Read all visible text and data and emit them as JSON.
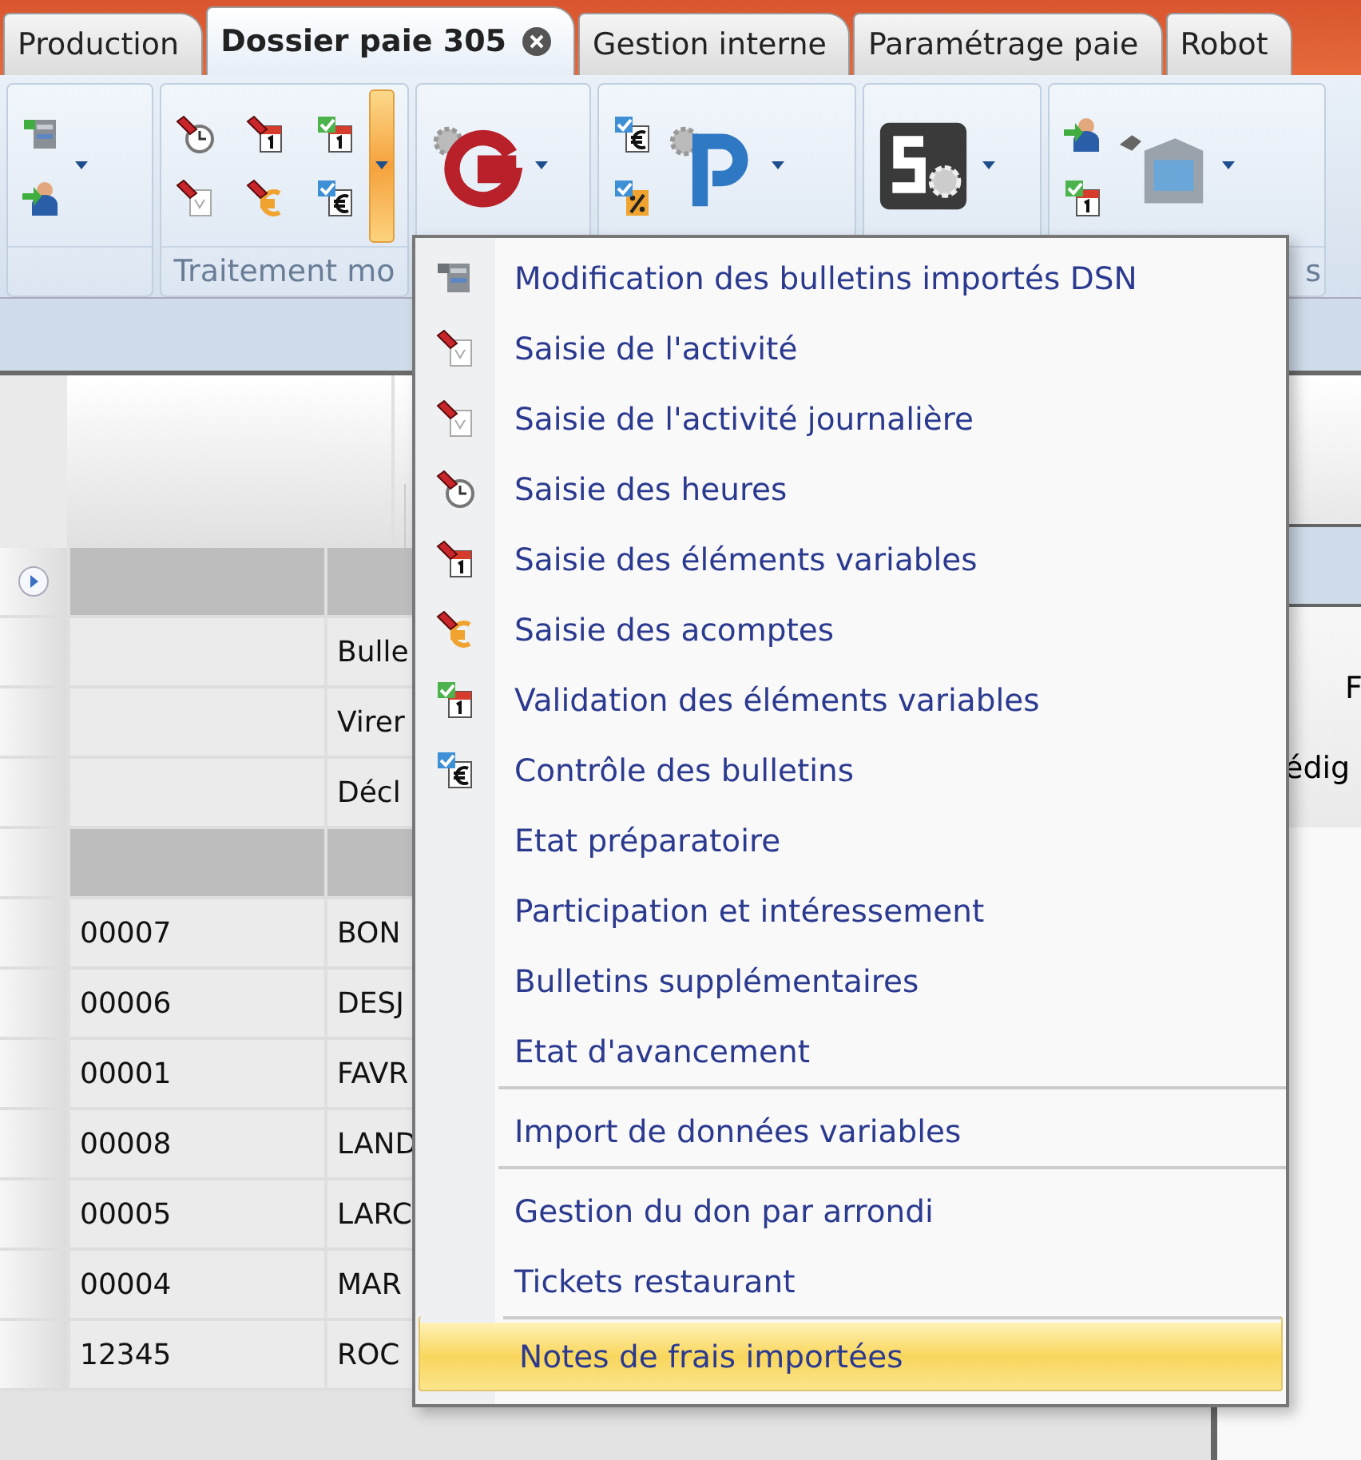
{
  "tabs": [
    {
      "label": "Production",
      "selected": false
    },
    {
      "label": "Dossier paie 305",
      "selected": true
    },
    {
      "label": "Gestion interne",
      "selected": false
    },
    {
      "label": "Paramétrage paie",
      "selected": false
    },
    {
      "label": "Robot",
      "selected": false
    }
  ],
  "ribbon": {
    "dropdown_expanded": true,
    "groups": [
      {
        "kind": "people"
      },
      {
        "kind": "treatment",
        "label": "Traitement mo"
      },
      {
        "kind": "g"
      },
      {
        "kind": "p"
      },
      {
        "kind": "so"
      },
      {
        "kind": "building",
        "label": "s"
      }
    ]
  },
  "grid": {
    "rows": [
      {
        "kind": "group_expandable"
      },
      {
        "kind": "summary",
        "column_2": "Bulle"
      },
      {
        "kind": "summary",
        "column_2": "Virer"
      },
      {
        "kind": "summary",
        "column_2": "Décl"
      },
      {
        "kind": "group"
      },
      {
        "kind": "data",
        "column_1": "00007",
        "column_2": "BON"
      },
      {
        "kind": "data",
        "column_1": "00006",
        "column_2": "DESJ"
      },
      {
        "kind": "data",
        "column_1": "00001",
        "column_2": "FAVR"
      },
      {
        "kind": "data",
        "column_1": "00008",
        "column_2": "LAND"
      },
      {
        "kind": "data",
        "column_1": "00005",
        "column_2": "LARC"
      },
      {
        "kind": "data",
        "column_1": "00004",
        "column_2": "MAR"
      },
      {
        "kind": "data",
        "column_1": "12345",
        "column_2": "ROC"
      }
    ]
  },
  "side_panel": {
    "texts": [
      "F",
      "édig"
    ]
  },
  "menu": {
    "items": [
      {
        "label": "Modification des bulletins importés DSN",
        "selected": false,
        "separator_before": false
      },
      {
        "label": "Saisie de l'activité",
        "selected": false,
        "separator_before": false
      },
      {
        "label": "Saisie de l'activité journalière",
        "selected": false,
        "separator_before": false
      },
      {
        "label": "Saisie des heures",
        "selected": false,
        "separator_before": false
      },
      {
        "label": "Saisie des éléments variables",
        "selected": false,
        "separator_before": false
      },
      {
        "label": "Saisie des acomptes",
        "selected": false,
        "separator_before": false
      },
      {
        "label": "Validation des éléments variables",
        "selected": false,
        "separator_before": false
      },
      {
        "label": "Contrôle des bulletins",
        "selected": false,
        "separator_before": false
      },
      {
        "label": "Etat préparatoire",
        "selected": false,
        "separator_before": false
      },
      {
        "label": "Participation et intéressement",
        "selected": false,
        "separator_before": false
      },
      {
        "label": "Bulletins supplémentaires",
        "selected": false,
        "separator_before": false
      },
      {
        "label": "Etat d'avancement",
        "selected": false,
        "separator_before": false
      },
      {
        "label": "Import de données variables",
        "selected": false,
        "separator_before": true
      },
      {
        "label": "Gestion du don par arrondi",
        "selected": false,
        "separator_before": true
      },
      {
        "label": "Tickets restaurant",
        "selected": false,
        "separator_before": false
      },
      {
        "label": "Notes de frais importées",
        "selected": true,
        "separator_before": true
      }
    ]
  }
}
